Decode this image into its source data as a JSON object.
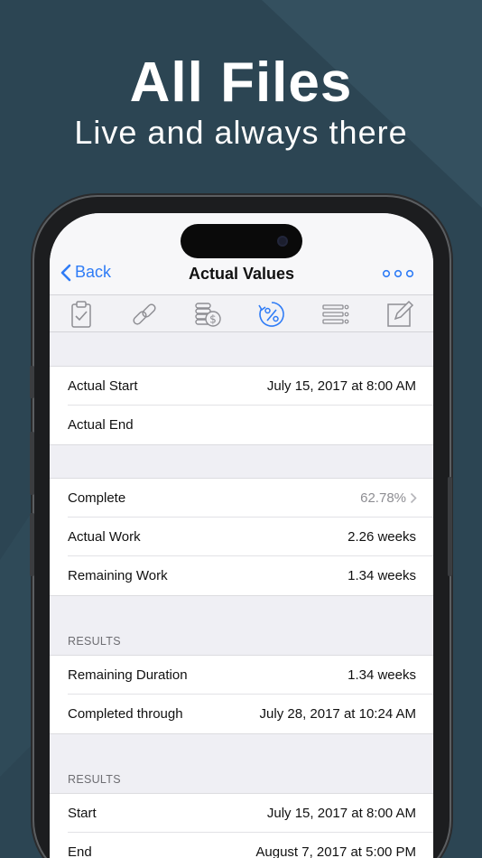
{
  "promo": {
    "headline": "All Files",
    "subline": "Live and always there"
  },
  "colors": {
    "background": "#2c4553",
    "accent": "#2f7cf6",
    "screen_bg": "#efeff4"
  },
  "nav": {
    "back_label": "Back",
    "title": "Actual Values",
    "more_icon": "ellipsis-icon"
  },
  "toolbar": {
    "tools": [
      "clipboard-check-icon",
      "link-icon",
      "coins-dollar-icon",
      "percent-progress-icon",
      "list-icon",
      "edit-icon"
    ],
    "active": "percent-progress-icon"
  },
  "groups": {
    "dates": [
      {
        "label": "Actual Start",
        "value": "July 15, 2017 at 8:00 AM"
      },
      {
        "label": "Actual End",
        "value": ""
      }
    ],
    "work": [
      {
        "label": "Complete",
        "value": "62.78%"
      },
      {
        "label": "Actual Work",
        "value": "2.26 weeks"
      },
      {
        "label": "Remaining Work",
        "value": "1.34 weeks"
      }
    ],
    "results1_header": "RESULTS",
    "results1": [
      {
        "label": "Remaining Duration",
        "value": "1.34 weeks"
      },
      {
        "label": "Completed through",
        "value": "July 28, 2017 at 10:24 AM"
      }
    ],
    "results2_header": "RESULTS",
    "results2": [
      {
        "label": "Start",
        "value": "July 15, 2017 at 8:00 AM"
      },
      {
        "label": "End",
        "value": "August 7, 2017 at 5:00 PM"
      }
    ]
  }
}
